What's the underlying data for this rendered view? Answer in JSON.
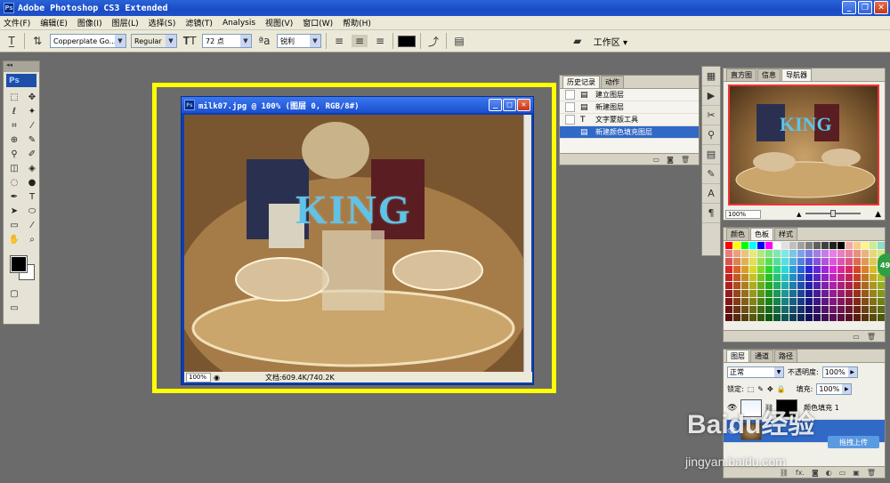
{
  "app": {
    "title": "Adobe Photoshop CS3 Extended"
  },
  "menu": [
    "文件(F)",
    "编辑(E)",
    "图像(I)",
    "图层(L)",
    "选择(S)",
    "滤镜(T)",
    "Analysis",
    "视图(V)",
    "窗口(W)",
    "帮助(H)"
  ],
  "options_bar": {
    "font_family": "Copperplate Go...",
    "font_style": "Regular",
    "font_size": "72 点",
    "anti_alias": "锐利",
    "workspace_label": "工作区 ▾",
    "text_color": "#000000"
  },
  "document": {
    "title": "milk07.jpg @ 100% (图层 0, RGB/8#)",
    "zoom": "100%",
    "info": "文档:609.4K/740.2K",
    "canvas_text": "KING",
    "text_color": "#5fc3e8"
  },
  "history": {
    "tabs": [
      "历史记录",
      "动作"
    ],
    "items": [
      "建立图层",
      "新建图层",
      "文字蒙版工具",
      "新建颜色填充图层"
    ],
    "selected_index": 3
  },
  "navigator": {
    "tabs": [
      "直方图",
      "信息",
      "导航器"
    ],
    "zoom": "100%",
    "thumb_text": "KING"
  },
  "swatches": {
    "tabs": [
      "颜色",
      "色板",
      "样式"
    ]
  },
  "layers": {
    "tabs": [
      "图层",
      "通道",
      "路径"
    ],
    "blend_mode": "正常",
    "opacity_label": "不透明度:",
    "opacity_value": "100%",
    "lock_label": "锁定:",
    "fill_label": "填充:",
    "fill_value": "100%",
    "items": [
      {
        "name": "颜色填充 1"
      },
      {
        "name": ""
      }
    ]
  },
  "overlay": {
    "badge": "49",
    "upload": "拖拽上传",
    "watermark": "Baidu经验",
    "watermark_url": "jingyan.baidu.com"
  }
}
